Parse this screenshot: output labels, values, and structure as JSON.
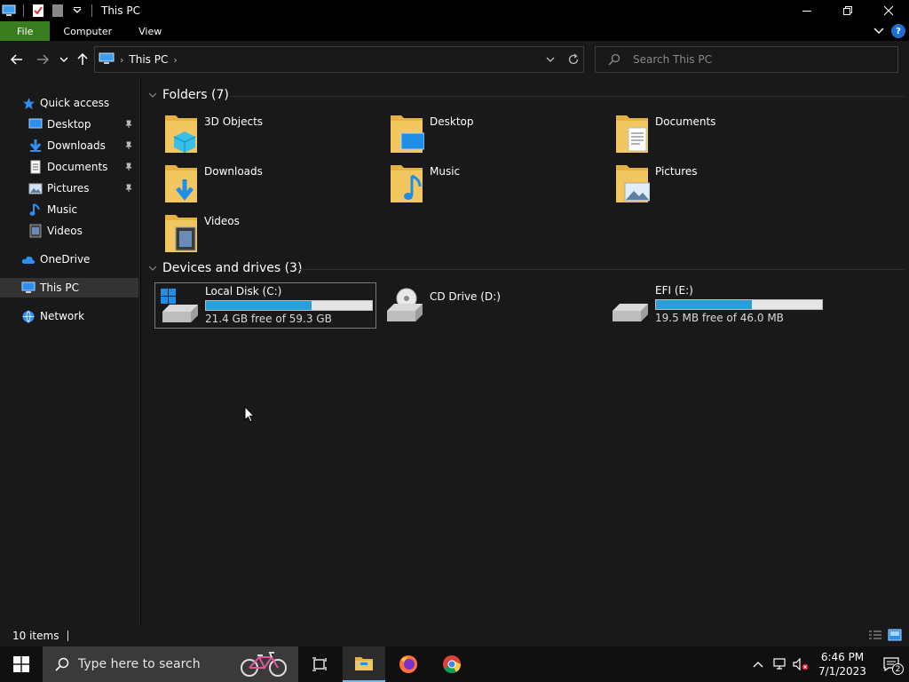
{
  "window": {
    "title": "This PC"
  },
  "ribbon": {
    "tabs": [
      "File",
      "Computer",
      "View"
    ]
  },
  "address": {
    "crumb": "This PC"
  },
  "search": {
    "placeholder": "Search This PC"
  },
  "sidebar": {
    "items": [
      {
        "label": "Quick access",
        "icon": "star-icon"
      },
      {
        "label": "Desktop",
        "icon": "desktop-icon",
        "pinned": true
      },
      {
        "label": "Downloads",
        "icon": "download-icon",
        "pinned": true
      },
      {
        "label": "Documents",
        "icon": "document-icon",
        "pinned": true
      },
      {
        "label": "Pictures",
        "icon": "pictures-icon",
        "pinned": true
      },
      {
        "label": "Music",
        "icon": "music-icon"
      },
      {
        "label": "Videos",
        "icon": "videos-icon"
      },
      {
        "label": "OneDrive",
        "icon": "cloud-icon"
      },
      {
        "label": "This PC",
        "icon": "computer-icon",
        "selected": true
      },
      {
        "label": "Network",
        "icon": "network-icon"
      }
    ]
  },
  "main": {
    "folders_header": "Folders (7)",
    "folders": [
      {
        "name": "3D Objects",
        "icon": "3d-objects-icon"
      },
      {
        "name": "Desktop",
        "icon": "desktop-folder-icon"
      },
      {
        "name": "Documents",
        "icon": "documents-folder-icon"
      },
      {
        "name": "Downloads",
        "icon": "downloads-folder-icon"
      },
      {
        "name": "Music",
        "icon": "music-folder-icon"
      },
      {
        "name": "Pictures",
        "icon": "pictures-folder-icon"
      },
      {
        "name": "Videos",
        "icon": "videos-folder-icon"
      }
    ],
    "drives_header": "Devices and drives (3)",
    "drives": [
      {
        "name": "Local Disk (C:)",
        "free_text": "21.4 GB free of 59.3 GB",
        "used_fraction": 0.639,
        "icon": "windows-drive-icon"
      },
      {
        "name": "CD Drive (D:)",
        "icon": "cd-drive-icon"
      },
      {
        "name": "EFI (E:)",
        "free_text": "19.5 MB free of 46.0 MB",
        "used_fraction": 0.576,
        "icon": "drive-icon"
      }
    ]
  },
  "status": {
    "items_text": "10 items"
  },
  "taskbar": {
    "search_placeholder": "Type here to search",
    "time": "6:46 PM",
    "date": "7/1/2023",
    "notifications": "2"
  },
  "colors": {
    "accent": "#26a0da",
    "file_tab": "#3a7d20",
    "folder": "#f3c75f"
  }
}
